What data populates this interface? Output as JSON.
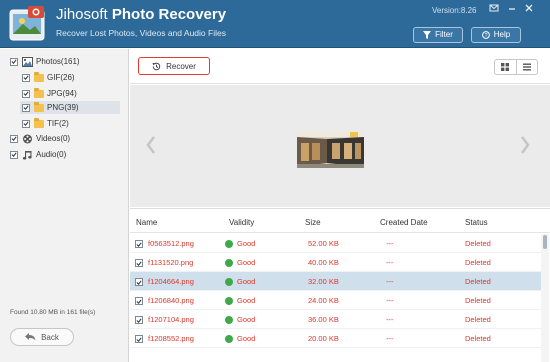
{
  "header": {
    "title_part1": "Jihosoft",
    "title_part2": "Photo Recovery",
    "subtitle": "Recover Lost Photos, Videos and Audio Files",
    "version": "Version:8.26",
    "filter_label": "Filter",
    "help_label": "Help",
    "accent": "#2d6a99"
  },
  "sidebar": {
    "tree": [
      {
        "label": "Photos(161)",
        "icon": "photos-icon"
      },
      {
        "label": "GIF(26)",
        "icon": "folder-icon"
      },
      {
        "label": "JPG(94)",
        "icon": "folder-icon"
      },
      {
        "label": "PNG(39)",
        "icon": "folder-icon",
        "selected": true
      },
      {
        "label": "TIF(2)",
        "icon": "folder-icon"
      },
      {
        "label": "Videos(0)",
        "icon": "film-reel-icon"
      },
      {
        "label": "Audio(0)",
        "icon": "music-note-icon"
      }
    ],
    "found_text": "Found 10.80 MB in 161 file(s)",
    "back_label": "Back"
  },
  "toolbar": {
    "recover_label": "Recover"
  },
  "table": {
    "headers": [
      "Name",
      "Validity",
      "Size",
      "Created Date",
      "Status"
    ],
    "rows": [
      {
        "name": "f0563512.png",
        "validity": "Good",
        "size": "52.00 KB",
        "created": "---",
        "status": "Deleted"
      },
      {
        "name": "f1131520.png",
        "validity": "Good",
        "size": "40.00 KB",
        "created": "---",
        "status": "Deleted"
      },
      {
        "name": "f1204664.png",
        "validity": "Good",
        "size": "32.00 KB",
        "created": "---",
        "status": "Deleted",
        "selected": true
      },
      {
        "name": "f1206840.png",
        "validity": "Good",
        "size": "24.00 KB",
        "created": "---",
        "status": "Deleted"
      },
      {
        "name": "f1207104.png",
        "validity": "Good",
        "size": "36.00 KB",
        "created": "---",
        "status": "Deleted"
      },
      {
        "name": "f1208552.png",
        "validity": "Good",
        "size": "20.00 KB",
        "created": "---",
        "status": "Deleted"
      }
    ]
  }
}
